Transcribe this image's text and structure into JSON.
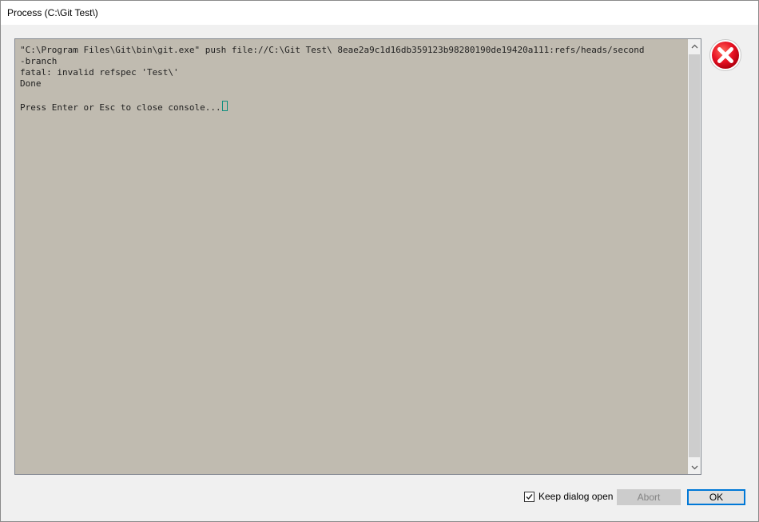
{
  "window": {
    "title": "Process (C:\\Git Test\\)"
  },
  "console": {
    "lines": [
      "\"C:\\Program Files\\Git\\bin\\git.exe\" push file://C:\\Git Test\\ 8eae2a9c1d16db359123b98280190de19420a111:refs/heads/second",
      "-branch",
      "fatal: invalid refspec 'Test\\'",
      "Done",
      "",
      "Press Enter or Esc to close console..."
    ],
    "background": "#c0bbb0"
  },
  "status": {
    "icon": "error-icon",
    "color": "#e81123"
  },
  "footer": {
    "keep_open_label": "Keep dialog open",
    "keep_open_checked": true,
    "abort_label": "Abort",
    "ok_label": "OK"
  }
}
